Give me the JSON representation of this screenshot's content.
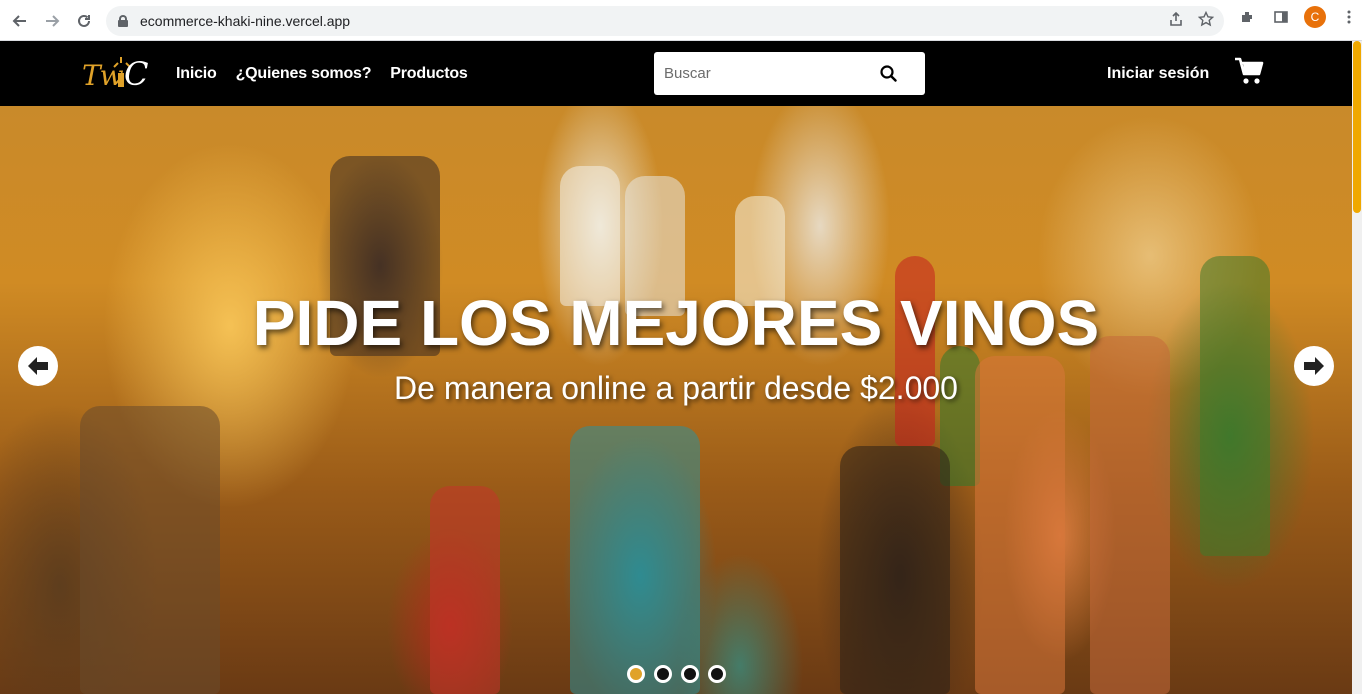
{
  "browser": {
    "url": "ecommerce-khaki-nine.vercel.app",
    "profile_initial": "C",
    "profile_color": "#e8710a"
  },
  "navbar": {
    "logo_text": "Tw C",
    "links": [
      "Inicio",
      "¿Quienes somos?",
      "Productos"
    ],
    "search_placeholder": "Buscar",
    "login_label": "Iniciar sesión",
    "accent_color": "#e0a229"
  },
  "hero": {
    "title": "PIDE LOS MEJORES VINOS",
    "subtitle": "De manera online a partir desde $2.000",
    "slides_count": 4,
    "active_slide": 1
  }
}
